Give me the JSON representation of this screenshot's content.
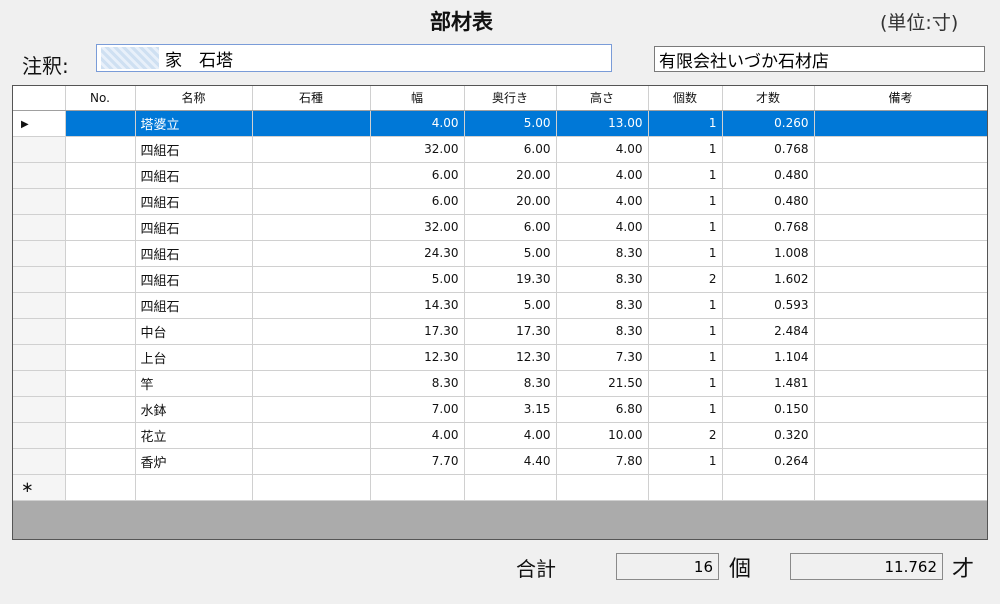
{
  "header": {
    "title": "部材表",
    "unit": "(単位:寸)"
  },
  "note": {
    "label": "注釈:",
    "value": "家　石塔",
    "company": "有限会社いづか石材店"
  },
  "icons": {
    "current_row": "current-row-arrow-icon",
    "new_row": "new-row-asterisk-icon"
  },
  "grid": {
    "columns": [
      "No.",
      "名称",
      "石種",
      "幅",
      "奥行き",
      "高さ",
      "個数",
      "才数",
      "備考"
    ],
    "current_marker": "▶",
    "new_marker": "∗",
    "rows": [
      {
        "no": "",
        "name": "塔婆立",
        "stone": "",
        "w": "4.00",
        "d": "5.00",
        "h": "13.00",
        "qty": "1",
        "sai": "0.260",
        "note": ""
      },
      {
        "no": "",
        "name": "四組石",
        "stone": "",
        "w": "32.00",
        "d": "6.00",
        "h": "4.00",
        "qty": "1",
        "sai": "0.768",
        "note": ""
      },
      {
        "no": "",
        "name": "四組石",
        "stone": "",
        "w": "6.00",
        "d": "20.00",
        "h": "4.00",
        "qty": "1",
        "sai": "0.480",
        "note": ""
      },
      {
        "no": "",
        "name": "四組石",
        "stone": "",
        "w": "6.00",
        "d": "20.00",
        "h": "4.00",
        "qty": "1",
        "sai": "0.480",
        "note": ""
      },
      {
        "no": "",
        "name": "四組石",
        "stone": "",
        "w": "32.00",
        "d": "6.00",
        "h": "4.00",
        "qty": "1",
        "sai": "0.768",
        "note": ""
      },
      {
        "no": "",
        "name": "四組石",
        "stone": "",
        "w": "24.30",
        "d": "5.00",
        "h": "8.30",
        "qty": "1",
        "sai": "1.008",
        "note": ""
      },
      {
        "no": "",
        "name": "四組石",
        "stone": "",
        "w": "5.00",
        "d": "19.30",
        "h": "8.30",
        "qty": "2",
        "sai": "1.602",
        "note": ""
      },
      {
        "no": "",
        "name": "四組石",
        "stone": "",
        "w": "14.30",
        "d": "5.00",
        "h": "8.30",
        "qty": "1",
        "sai": "0.593",
        "note": ""
      },
      {
        "no": "",
        "name": "中台",
        "stone": "",
        "w": "17.30",
        "d": "17.30",
        "h": "8.30",
        "qty": "1",
        "sai": "2.484",
        "note": ""
      },
      {
        "no": "",
        "name": "上台",
        "stone": "",
        "w": "12.30",
        "d": "12.30",
        "h": "7.30",
        "qty": "1",
        "sai": "1.104",
        "note": ""
      },
      {
        "no": "",
        "name": "竿",
        "stone": "",
        "w": "8.30",
        "d": "8.30",
        "h": "21.50",
        "qty": "1",
        "sai": "1.481",
        "note": ""
      },
      {
        "no": "",
        "name": "水鉢",
        "stone": "",
        "w": "7.00",
        "d": "3.15",
        "h": "6.80",
        "qty": "1",
        "sai": "0.150",
        "note": ""
      },
      {
        "no": "",
        "name": "花立",
        "stone": "",
        "w": "4.00",
        "d": "4.00",
        "h": "10.00",
        "qty": "2",
        "sai": "0.320",
        "note": ""
      },
      {
        "no": "",
        "name": "香炉",
        "stone": "",
        "w": "7.70",
        "d": "4.40",
        "h": "7.80",
        "qty": "1",
        "sai": "0.264",
        "note": ""
      }
    ]
  },
  "footer": {
    "label": "合計",
    "count": "16",
    "count_unit": "個",
    "sai_total": "11.762",
    "sai_unit": "才"
  }
}
